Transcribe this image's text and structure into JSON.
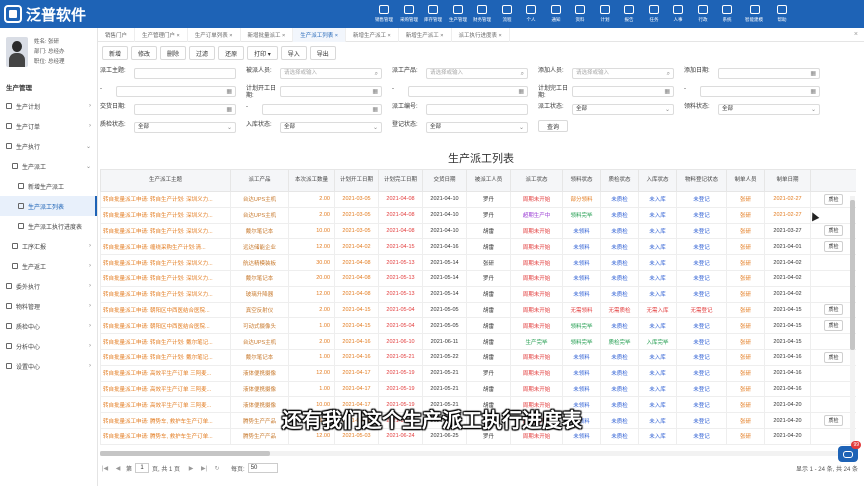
{
  "app": {
    "logo_text": "泛普软件"
  },
  "topnav": [
    "销售管理",
    "采购管理",
    "库存管理",
    "生产管理",
    "财务管理",
    "流程",
    "个人",
    "通知",
    "资料",
    "计划",
    "报告",
    "任务",
    "人事",
    "行政",
    "系统",
    "智能建模",
    "帮助"
  ],
  "profile": {
    "name_line": "姓名: 张研",
    "dept_line": "部门: 总经办",
    "post_line": "职位: 总经理"
  },
  "sidebar": {
    "section_title": "生产管理",
    "items": [
      {
        "label": "生产计划",
        "level": 1,
        "arrow": "›"
      },
      {
        "label": "生产订单",
        "level": 1,
        "arrow": "›"
      },
      {
        "label": "生产执行",
        "level": 1,
        "arrow": "⌄"
      },
      {
        "label": "生产派工",
        "level": 2,
        "arrow": "⌄"
      },
      {
        "label": "新增生产派工",
        "level": 3,
        "arrow": ""
      },
      {
        "label": "生产派工列表",
        "level": 3,
        "arrow": "",
        "active": true
      },
      {
        "label": "生产派工执行进度表",
        "level": 3,
        "arrow": ""
      },
      {
        "label": "工序汇报",
        "level": 2,
        "arrow": "›"
      },
      {
        "label": "生产返工",
        "level": 2,
        "arrow": "›"
      },
      {
        "label": "委外执行",
        "level": 1,
        "arrow": "›"
      },
      {
        "label": "物料管理",
        "level": 1,
        "arrow": "›"
      },
      {
        "label": "质检中心",
        "level": 1,
        "arrow": "›"
      },
      {
        "label": "分析中心",
        "level": 1,
        "arrow": "›"
      },
      {
        "label": "设置中心",
        "level": 1,
        "arrow": "›"
      }
    ]
  },
  "tabs": [
    {
      "label": "销售门户"
    },
    {
      "label": "生产管理门户 ×"
    },
    {
      "label": "生产订单列表 ×"
    },
    {
      "label": "新增批量派工 ×"
    },
    {
      "label": "生产派工列表 ×",
      "active": true
    },
    {
      "label": "新增生产派工 ×"
    },
    {
      "label": "新增生产派工 ×"
    },
    {
      "label": "派工执行进度表 ×"
    }
  ],
  "tabs_close": "×",
  "toolbar": [
    "新增",
    "修改",
    "删除",
    "过滤",
    "还原",
    "打印 ▾",
    "导入",
    "导出"
  ],
  "filters": {
    "row1": [
      {
        "label": "派工主题:",
        "value": "",
        "icon": ""
      },
      {
        "label": "被派人员:",
        "value": "请选择或输入",
        "icon": "⌕"
      },
      {
        "label": "派工产品:",
        "value": "请选择或输入",
        "icon": "⌕"
      },
      {
        "label": "添加人员:",
        "value": "请选择或输入",
        "icon": "⌕"
      },
      {
        "label": "添加日期:",
        "value": "",
        "icon": "▦"
      }
    ],
    "row2": [
      {
        "label": "-",
        "value": "",
        "icon": "▦"
      },
      {
        "label": "计划开工日期:",
        "value": "",
        "icon": "▦"
      },
      {
        "label": "-",
        "value": "",
        "icon": "▦"
      },
      {
        "label": "计划完工日期:",
        "value": "",
        "icon": "▦"
      },
      {
        "label": "-",
        "value": "",
        "icon": "▦"
      }
    ],
    "row3": [
      {
        "label": "交货日期:",
        "value": "",
        "icon": "▦"
      },
      {
        "label": "-",
        "value": "",
        "icon": "▦"
      },
      {
        "label": "派工编号:",
        "value": "",
        "icon": ""
      },
      {
        "label": "派工状态:",
        "value": "全部",
        "icon": "⌄"
      },
      {
        "label": "领料状态:",
        "value": "全部",
        "icon": "⌄"
      }
    ],
    "row4": [
      {
        "label": "质检状态:",
        "value": "全部",
        "icon": "⌄"
      },
      {
        "label": "入库状态:",
        "value": "全部",
        "icon": "⌄"
      },
      {
        "label": "登记状态:",
        "value": "全部",
        "icon": "⌄"
      }
    ],
    "query_button": "查询"
  },
  "table": {
    "title": "生产派工列表",
    "columns": [
      "生产派工主题",
      "派工产品",
      "本次派工数量",
      "计划开工日期",
      "计划完工日期",
      "交货日期",
      "被派工人员",
      "派工状态",
      "领料状态",
      "质检状态",
      "入库状态",
      "物料登记状态",
      "制单人员",
      "制单日期",
      ""
    ],
    "rows": [
      [
        "转自批量派工申请: 转自生产计划: 深圳义力...",
        "台达UPS主机",
        "2.00",
        "2021-03-05",
        "2021-04-08",
        "2021-04-10",
        "罗丹",
        "周期未开始",
        "部分领料",
        "未质检",
        "未入库",
        "未登记",
        "张研",
        "2021-02-27",
        "质检"
      ],
      [
        "转自批量派工申请: 转自生产计划: 深圳义力...",
        "台达UPS主机",
        "2.00",
        "2021-03-05",
        "2021-04-08",
        "2021-04-10",
        "罗丹",
        "超期生产中",
        "领料完毕",
        "未质检",
        "未入库",
        "未登记",
        "张研",
        "2021-02-27",
        ""
      ],
      [
        "转自批量派工申请: 转自生产计划: 深圳义力...",
        "戴尔笔记本",
        "10.00",
        "2021-03-05",
        "2021-04-08",
        "2021-04-10",
        "胡雷",
        "周期未开始",
        "未领料",
        "未质检",
        "未入库",
        "未登记",
        "张研",
        "2021-03-27",
        "质检"
      ],
      [
        "转自批量派工申请: 缠绕采购生产计划:清...",
        "远达储能企业",
        "12.00",
        "2021-04-02",
        "2021-04-15",
        "2021-04-16",
        "胡雷",
        "周期未开始",
        "未领料",
        "未质检",
        "未入库",
        "未登记",
        "张研",
        "2021-04-01",
        "质检"
      ],
      [
        "转自批量派工申请: 转自生产计划: 深圳义力...",
        "航达精模装板",
        "30.00",
        "2021-04-08",
        "2021-05-13",
        "2021-05-14",
        "张研",
        "周期未开始",
        "未领料",
        "未质检",
        "未入库",
        "未登记",
        "张研",
        "2021-04-02",
        ""
      ],
      [
        "转自批量派工申请: 转自生产计划: 深圳义力...",
        "戴尔笔记本",
        "20.00",
        "2021-04-08",
        "2021-05-13",
        "2021-05-14",
        "罗丹",
        "周期未开始",
        "未领料",
        "未质检",
        "未入库",
        "未登记",
        "张研",
        "2021-04-02",
        ""
      ],
      [
        "转自批量派工申请: 转自生产计划: 深圳义力...",
        "玻璃升降器",
        "12.00",
        "2021-04-08",
        "2021-05-13",
        "2021-05-14",
        "胡雷",
        "周期未开始",
        "未领料",
        "未质检",
        "未入库",
        "未登记",
        "张研",
        "2021-04-02",
        ""
      ],
      [
        "转自批量派工申请: 朝阳区中西医结合医院...",
        "真空反射仪",
        "2.00",
        "2021-04-15",
        "2021-05-04",
        "2021-05-05",
        "胡雷",
        "周期未开始",
        "无需领料",
        "无需质检",
        "无需入库",
        "无需登记",
        "张研",
        "2021-04-15",
        "质检"
      ],
      [
        "转自批量派工申请: 朝阳区中西医结合医院...",
        "可动式摄像头",
        "1.00",
        "2021-04-15",
        "2021-05-04",
        "2021-05-05",
        "胡雷",
        "周期未开始",
        "领料完毕",
        "未质检",
        "未入库",
        "未登记",
        "张研",
        "2021-04-15",
        "质检"
      ],
      [
        "转自批量派工申请: 转自生产计划: 戴尔笔记...",
        "台达UPS主机",
        "2.00",
        "2021-04-16",
        "2021-06-10",
        "2021-06-11",
        "胡雷",
        "生产完毕",
        "领料完毕",
        "质检完毕",
        "入库完毕",
        "未登记",
        "张研",
        "2021-04-15",
        ""
      ],
      [
        "转自批量派工申请: 转自生产计划: 戴尔笔记...",
        "戴尔笔记本",
        "1.00",
        "2021-04-16",
        "2021-05-21",
        "2021-05-22",
        "胡雷",
        "周期未开始",
        "未领料",
        "未质检",
        "未入库",
        "未登记",
        "张研",
        "2021-04-16",
        "质检"
      ],
      [
        "转自批量派工申请: 高效平生产订单 三阿麦...",
        "液体便携摄像",
        "12.00",
        "2021-04-17",
        "2021-05-19",
        "2021-05-21",
        "罗丹",
        "周期未开始",
        "未领料",
        "未质检",
        "未入库",
        "未登记",
        "张研",
        "2021-04-16",
        ""
      ],
      [
        "转自批量派工申请: 高效平生产订单 三阿麦...",
        "液体便携摄像",
        "1.00",
        "2021-04-17",
        "2021-05-19",
        "2021-05-21",
        "胡雷",
        "周期未开始",
        "未领料",
        "未质检",
        "未入库",
        "未登记",
        "张研",
        "2021-04-16",
        ""
      ],
      [
        "转自批量派工申请: 高效平生产订单 三阿麦...",
        "液体便携摄像",
        "10.00",
        "2021-04-17",
        "2021-05-19",
        "2021-05-21",
        "胡雷",
        "周期未开始",
        "未领料",
        "未质检",
        "未入库",
        "未登记",
        "张研",
        "2021-04-20",
        ""
      ],
      [
        "转自批量派工申请: 腾势车, 救护车生产订单...",
        "腾势生产产品",
        "16.16",
        "2021-05-02",
        "2021-07-16",
        "2021-07-16",
        "罗丹",
        "周期未开始",
        "未领料",
        "未质检",
        "未入库",
        "未登记",
        "张研",
        "2021-04-20",
        "质检"
      ],
      [
        "转自批量派工申请: 腾势车, 救护车生产订单...",
        "腾势生产产品",
        "12.00",
        "2021-05-03",
        "2021-06-24",
        "2021-06-25",
        "罗丹",
        "周期未开始",
        "未领料",
        "未质检",
        "未入库",
        "未登记",
        "张研",
        "2021-04-20",
        ""
      ]
    ]
  },
  "pager": {
    "first": "|◀",
    "prev": "◀",
    "page_label_pre": "第",
    "page": "1",
    "page_label_post": "页, 共 1 页",
    "next": "▶",
    "last": "▶|",
    "refresh": "↻",
    "size_label": "每页:",
    "size": "50",
    "info": "显示 1 - 24 条, 共 24 条"
  },
  "subtitle": "还有我们这个生产派工执行进度表",
  "chat_badge": "99"
}
